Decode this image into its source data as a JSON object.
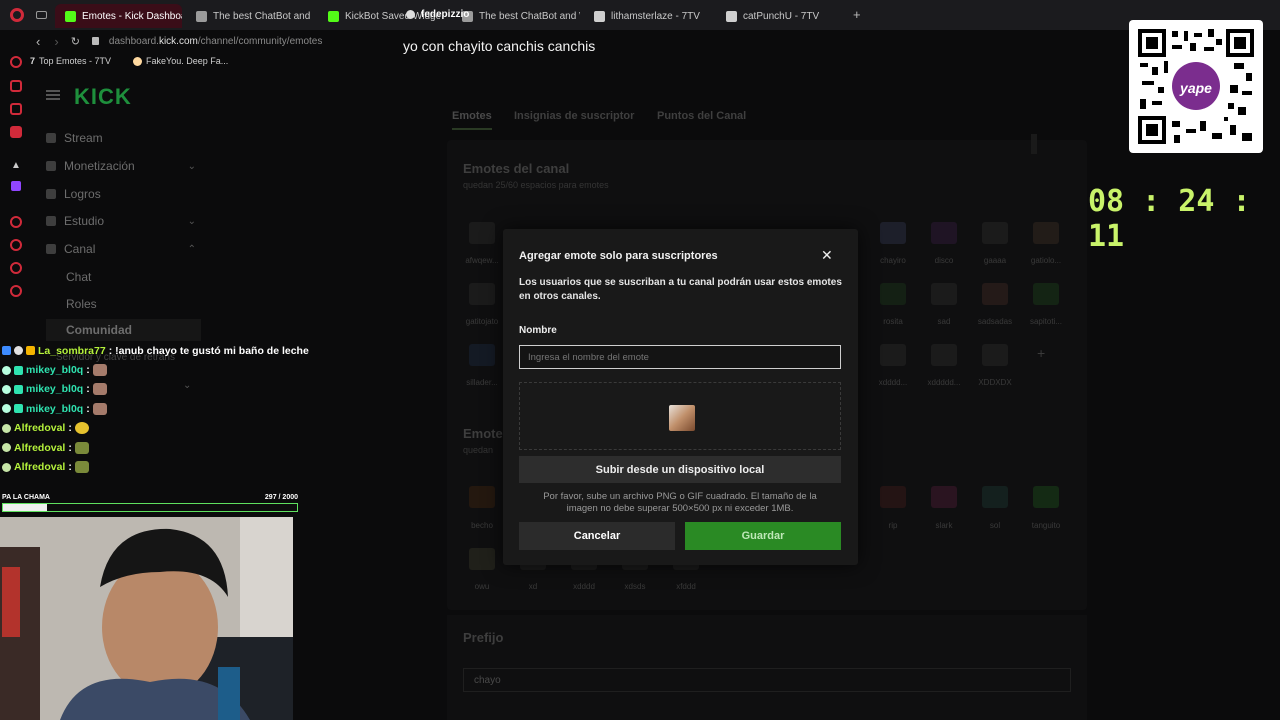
{
  "browser": {
    "tabs": [
      {
        "label": "Emotes - Kick Dashboard",
        "active": true,
        "color": "#53fc18"
      },
      {
        "label": "The best ChatBot and",
        "active": false,
        "color": "#9b9b9b"
      },
      {
        "label": "KickBot Saved Widget",
        "active": false,
        "color": "#53fc18"
      },
      {
        "label": "The best ChatBot and W",
        "active": false,
        "color": "#9b9b9b"
      },
      {
        "label": "lithamsterlaze - 7TV",
        "active": false,
        "color": "#cfcfcf"
      },
      {
        "label": "catPunchU - 7TV",
        "active": false,
        "color": "#cfcfcf"
      }
    ],
    "new_tab": "+",
    "url_domain": "dashboard.",
    "url_host": "kick.com",
    "url_path": "/channel/community/emotes",
    "bookmarks": [
      "Top Emotes - 7TV",
      "FakeYou. Deep Fa..."
    ]
  },
  "sidebar": {
    "logo": "KICK",
    "items": [
      {
        "label": "Stream",
        "icon": "broadcast-icon",
        "chevron": ""
      },
      {
        "label": "Monetización",
        "icon": "money-icon",
        "chevron": "⌄"
      },
      {
        "label": "Logros",
        "icon": "trophy-icon",
        "chevron": ""
      },
      {
        "label": "Estudio",
        "icon": "studio-icon",
        "chevron": "⌄"
      },
      {
        "label": "Canal",
        "icon": "users-icon",
        "chevron": "⌃"
      },
      {
        "label": "Chat",
        "icon": "",
        "chevron": ""
      },
      {
        "label": "Roles",
        "icon": "",
        "chevron": ""
      },
      {
        "label": "Comunidad",
        "icon": "",
        "chevron": ""
      },
      {
        "label": "Servidor y clave de retrans",
        "icon": "",
        "chevron": "⌄"
      }
    ]
  },
  "main": {
    "tabs": [
      "Emotes",
      "Insignias de suscriptor",
      "Puntos del Canal"
    ],
    "channel_emotes_title": "Emotes del canal",
    "channel_emotes_sub": "quedan 25/60 espacios para emotes",
    "channel_emotes_row1": [
      "afwqew...",
      "",
      "",
      "",
      "",
      "",
      "",
      "",
      "chayiro",
      "disco",
      "gaaaa",
      "gatiolo..."
    ],
    "channel_emotes_row2": [
      "gatitojato",
      "",
      "",
      "",
      "",
      "",
      "",
      "",
      "rosita",
      "sad",
      "sadsadas",
      "sapitoti..."
    ],
    "channel_emotes_row3": [
      "sillader...",
      "",
      "",
      "",
      "",
      "",
      "",
      "",
      "xdddd...",
      "xddddd...",
      "XDDXDX",
      "+"
    ],
    "sub_emotes_title": "Emotes",
    "sub_emotes_sub": "quedan",
    "sub_emotes_row1": [
      "becho",
      "",
      "",
      "",
      "",
      "",
      "",
      "",
      "rip",
      "slark",
      "sol",
      "tanguito"
    ],
    "sub_emotes_row2": [
      "owu",
      "xd",
      "xdddd",
      "xdsds",
      "xfddd"
    ],
    "prefix_title": "Prefijo",
    "prefix_value": "chayo"
  },
  "modal": {
    "title": "Agregar emote solo para suscriptores",
    "close": "✕",
    "description": "Los usuarios que se suscriban a tu canal podrán usar estos emotes en otros canales.",
    "name_label": "Nombre",
    "name_placeholder": "Ingresa el nombre del emote",
    "upload_label": "Subir desde un dispositivo local",
    "hint": "Por favor, sube un archivo PNG o GIF cuadrado. El tamaño de la imagen no debe superar 500×500 px ni exceder 1MB.",
    "cancel_label": "Cancelar",
    "save_label": "Guardar"
  },
  "overlay": {
    "streamer_name": "fedepizzio",
    "text": "yo con chayito canchis canchis",
    "clock": "08 : 24 : 11",
    "qr_brand": "yape"
  },
  "chat": [
    {
      "user": "La_sombra77",
      "message": ": !anub chayo te gustó mi baño de leche",
      "color": "#b5f23c"
    },
    {
      "user": "mikey_bl0q",
      "message": ":",
      "color": "#2fe3b0"
    },
    {
      "user": "mikey_bl0q",
      "message": ":",
      "color": "#2fe3b0"
    },
    {
      "user": "mikey_bl0q",
      "message": ":",
      "color": "#2fe3b0"
    },
    {
      "user": "Alfredoval",
      "message": ":",
      "color": "#b5f23c"
    },
    {
      "user": "Alfredoval",
      "message": ":",
      "color": "#b5f23c"
    },
    {
      "user": "Alfredoval",
      "message": ":",
      "color": "#b5f23c"
    }
  ],
  "goal": {
    "label": "PA LA CHAMA",
    "count": "297 / 2000",
    "progress": 0.15
  },
  "colors": {
    "accent": "#53fc18",
    "save_button": "#2a8a24",
    "clock": "#c9f36a"
  }
}
